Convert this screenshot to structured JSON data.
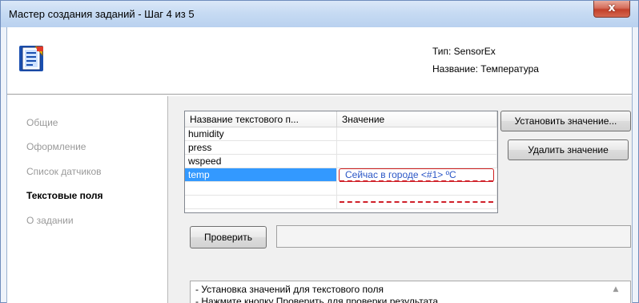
{
  "window": {
    "title": "Мастер создания заданий - Шаг 4 из 5",
    "close_glyph": "x"
  },
  "header": {
    "icon": "wizard-document-icon",
    "type_line": "Тип: SensorEx",
    "name_line": "Название: Температура"
  },
  "sidebar": {
    "items": [
      {
        "label": "Общие",
        "active": false
      },
      {
        "label": "Оформление",
        "active": false
      },
      {
        "label": "Список датчиков",
        "active": false
      },
      {
        "label": "Текстовые поля",
        "active": true
      },
      {
        "label": "О задании",
        "active": false
      }
    ]
  },
  "table": {
    "columns": [
      "Название текстового п...",
      "Значение"
    ],
    "rows": [
      {
        "name": "humidity",
        "value": ""
      },
      {
        "name": "press",
        "value": ""
      },
      {
        "name": "wspeed",
        "value": ""
      },
      {
        "name": "temp",
        "value": "Сейчас в городе <#1> ºC"
      }
    ]
  },
  "buttons": {
    "set_value": "Установить значение...",
    "delete_value": "Удалить значение",
    "check": "Проверить"
  },
  "check_result": "",
  "info": {
    "line1": "- Установка значений для текстового поля",
    "line2": "- Нажмите кнопку Проверить для проверки результата"
  },
  "colors": {
    "selection": "#3399ff",
    "highlight_dash": "#d0202a",
    "value_text": "#2a56c6",
    "close_button": "#c2402a"
  }
}
